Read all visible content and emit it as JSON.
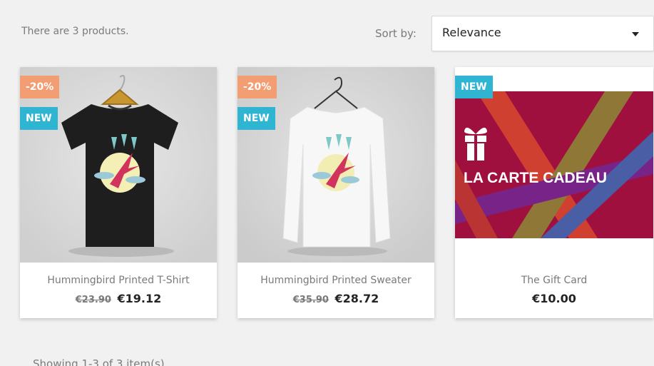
{
  "listing": {
    "count_text": "There are 3 products.",
    "sort_label": "Sort by:",
    "sort_value": "Relevance"
  },
  "products": [
    {
      "name": "Hummingbird Printed T-Shirt",
      "old_price": "€23.90",
      "price": "€19.12",
      "discount_flag": "-20%",
      "new_flag": "NEW",
      "image_icon": "tshirt-black-icon"
    },
    {
      "name": "Hummingbird Printed Sweater",
      "old_price": "€35.90",
      "price": "€28.72",
      "discount_flag": "-20%",
      "new_flag": "NEW",
      "image_icon": "sweater-white-icon"
    },
    {
      "name": "The Gift Card",
      "price": "€10.00",
      "new_flag": "NEW",
      "card_text": "LA CARTE CADEAU",
      "image_icon": "gift-card-icon"
    }
  ],
  "pagination": {
    "showing_text": "Showing 1-3 of 3 item(s)"
  },
  "colors": {
    "discount": "#f39d72",
    "new": "#2fb5d2",
    "card_background": "#a0103f"
  }
}
